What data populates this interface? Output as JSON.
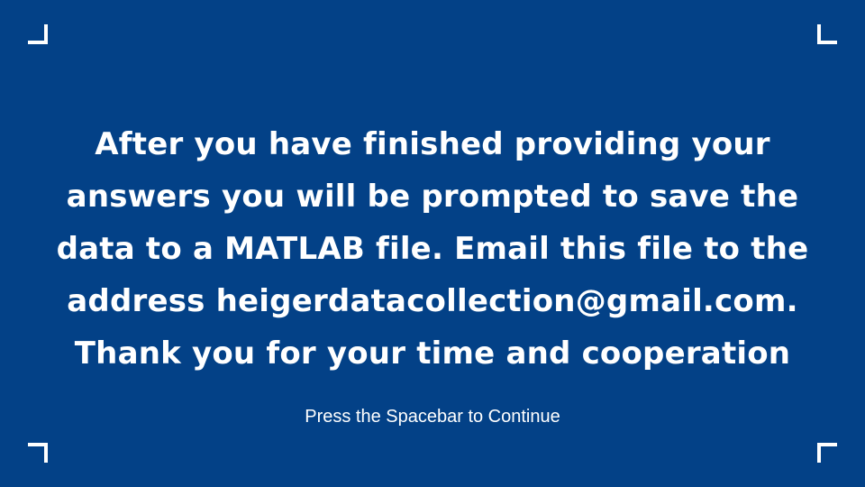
{
  "message": {
    "lines": [
      "After you have finished providing your",
      "answers you will be prompted to save the",
      "data to a MATLAB file. Email this file to the",
      "address heigerdatacollection@gmail.com.",
      "Thank you for your time and cooperation"
    ]
  },
  "prompt": {
    "text": "Press the Spacebar to Continue"
  },
  "colors": {
    "background": "#034187",
    "text": "#ffffff"
  }
}
